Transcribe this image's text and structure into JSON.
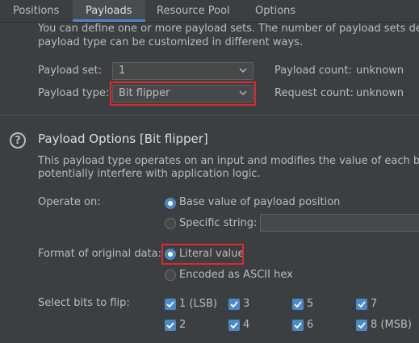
{
  "tabs": [
    "Positions",
    "Payloads",
    "Resource Pool",
    "Options"
  ],
  "intro": {
    "line1": "You can define one or more payload sets. The number of payload sets dep",
    "line2": "payload type can be customized in different ways."
  },
  "payload_set": {
    "label": "Payload set:",
    "value": "1"
  },
  "payload_type": {
    "label": "Payload type:",
    "value": "Bit flipper"
  },
  "payload_count": {
    "label": "Payload count:",
    "value": "unknown"
  },
  "request_count": {
    "label": "Request count:",
    "value": "unknown"
  },
  "options": {
    "help_glyph": "?",
    "title": "Payload Options [Bit flipper]",
    "desc1": "This payload type operates on an input and modifies the value of each bit",
    "desc2": "potentially interfere with application logic.",
    "operate_on": {
      "label": "Operate on:",
      "opt_base": "Base value of payload position",
      "opt_specific": "Specific string:",
      "selected": "Base value of payload position"
    },
    "format": {
      "label": "Format of original data:",
      "opt_literal": "Literal value",
      "opt_ascii": "Encoded as ASCII hex",
      "selected": "Literal value"
    },
    "bits": {
      "label": "Select bits to flip:",
      "items": [
        "1 (LSB)",
        "3",
        "5",
        "7",
        "2",
        "4",
        "6",
        "8 (MSB)"
      ],
      "checked": [
        true,
        true,
        true,
        true,
        true,
        true,
        true,
        true
      ]
    }
  },
  "colors": {
    "accent": "#4a88c7",
    "highlight": "#e0282e",
    "background": "#3c3f41"
  }
}
